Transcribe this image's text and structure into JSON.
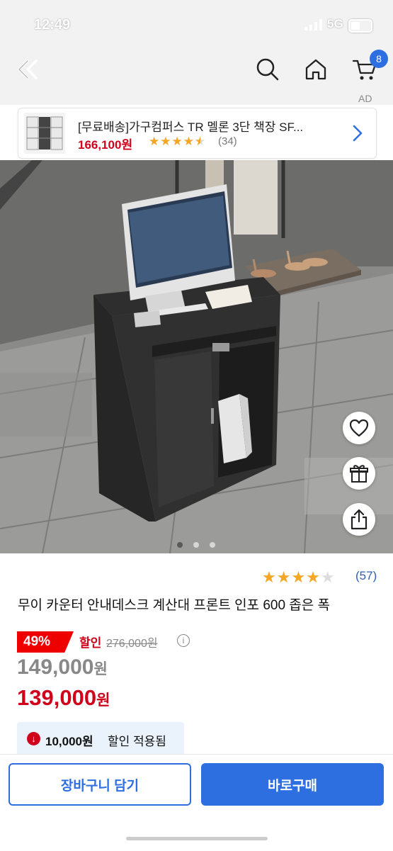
{
  "status": {
    "time": "12:49",
    "network": "5G"
  },
  "header": {
    "cart_count": "8",
    "ad_label": "AD"
  },
  "ad": {
    "title": "[무료배송]가구컴퍼스 TR 멜론 3단 책장 SF...",
    "price": "166,100원",
    "stars": "★★★★★",
    "rating": 4.5,
    "review_count": "(34)"
  },
  "product": {
    "rating_stars": "★★★★★",
    "rating": 4,
    "review_count": "(57)",
    "title": "무이 카운터 안내데스크 계산대 프론트 인포 600 좁은 폭",
    "discount_percent": "49%",
    "discount_label": "할인",
    "original_price": "276,000원",
    "info_glyph": "i",
    "price_1_number": "149,000",
    "price_1_unit": "원",
    "price_2_number": "139,000",
    "price_2_unit": "원",
    "coupon_amount": "10,000원",
    "coupon_text": "할인 적용됨",
    "image_pages": 3,
    "image_current": 1
  },
  "buttons": {
    "cart": "장바구니 담기",
    "buy": "바로구매"
  },
  "colors": {
    "accent": "#2d6fe0",
    "price_red": "#d0021b",
    "star": "#f5a623"
  }
}
